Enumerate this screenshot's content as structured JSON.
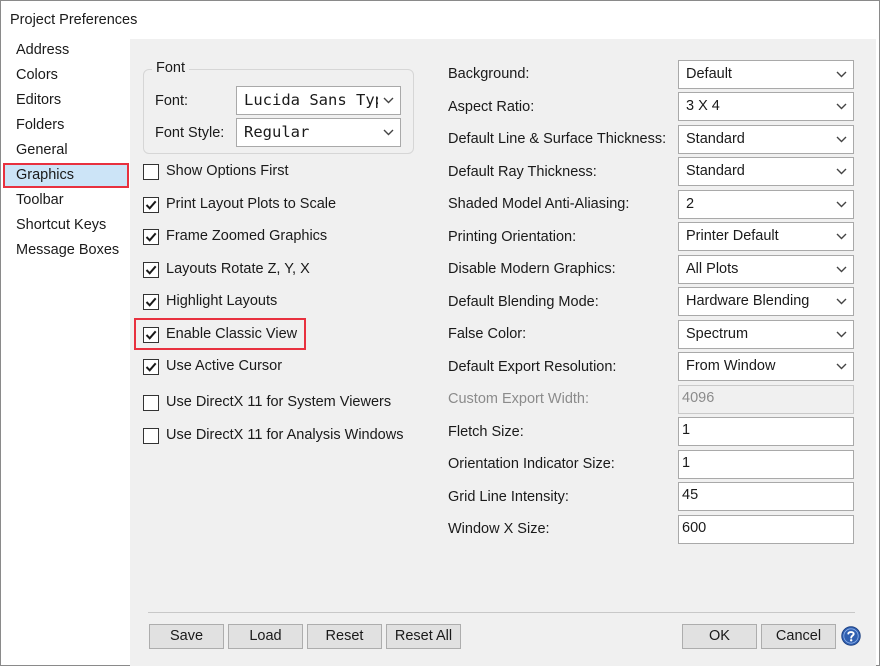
{
  "window": {
    "title": "Project Preferences"
  },
  "sidebar": {
    "items": [
      {
        "label": "Address"
      },
      {
        "label": "Colors"
      },
      {
        "label": "Editors"
      },
      {
        "label": "Folders"
      },
      {
        "label": "General"
      },
      {
        "label": "Graphics",
        "selected": true
      },
      {
        "label": "Toolbar"
      },
      {
        "label": "Shortcut Keys"
      },
      {
        "label": "Message Boxes"
      }
    ]
  },
  "font_group": {
    "title": "Font",
    "font_label": "Font:",
    "font_value": "Lucida Sans Typewriter",
    "style_label": "Font Style:",
    "style_value": "Regular"
  },
  "options": [
    {
      "label": "Show Options First",
      "checked": false
    },
    {
      "label": "Print Layout Plots to Scale",
      "checked": true
    },
    {
      "label": "Frame Zoomed Graphics",
      "checked": true
    },
    {
      "label": "Layouts Rotate Z, Y, X",
      "checked": true
    },
    {
      "label": "Highlight Layouts",
      "checked": true
    },
    {
      "label": "Enable Classic View",
      "checked": true,
      "highlighted": true
    },
    {
      "label": "Use Active Cursor",
      "checked": true
    },
    {
      "label": "Use DirectX 11 for System Viewers",
      "checked": false
    },
    {
      "label": "Use DirectX 11 for Analysis Windows",
      "checked": false
    }
  ],
  "settings": [
    {
      "label": "Background:",
      "type": "select",
      "value": "Default"
    },
    {
      "label": "Aspect Ratio:",
      "type": "select",
      "value": "3 X 4"
    },
    {
      "label": "Default Line & Surface Thickness:",
      "type": "select",
      "value": "Standard"
    },
    {
      "label": "Default Ray Thickness:",
      "type": "select",
      "value": "Standard"
    },
    {
      "label": "Shaded Model Anti-Aliasing:",
      "type": "select",
      "value": "2"
    },
    {
      "label": "Printing Orientation:",
      "type": "select",
      "value": "Printer Default"
    },
    {
      "label": "Disable Modern Graphics:",
      "type": "select",
      "value": "All Plots"
    },
    {
      "label": "Default Blending Mode:",
      "type": "select",
      "value": "Hardware Blending"
    },
    {
      "label": "False Color:",
      "type": "select",
      "value": "Spectrum"
    },
    {
      "label": "Default Export Resolution:",
      "type": "select",
      "value": "From Window"
    },
    {
      "label": "Custom Export Width:",
      "type": "text",
      "value": "4096",
      "disabled": true
    },
    {
      "label": "Fletch Size:",
      "type": "text",
      "value": "1"
    },
    {
      "label": "Orientation Indicator Size:",
      "type": "text",
      "value": "1"
    },
    {
      "label": "Grid Line Intensity:",
      "type": "text",
      "value": "45"
    },
    {
      "label": "Window X Size:",
      "type": "text",
      "value": "600"
    }
  ],
  "buttons": {
    "save": "Save",
    "load": "Load",
    "reset": "Reset",
    "reset_all": "Reset All",
    "ok": "OK",
    "cancel": "Cancel"
  },
  "icons": {
    "help": "help-icon",
    "chevron": "chevron-down-icon",
    "check": "checkmark-icon"
  },
  "colors": {
    "selection": "#cce4f7",
    "highlight_border": "#e8313f",
    "panel_bg": "#f0f0f0",
    "help_blue": "#2f5fb0"
  }
}
